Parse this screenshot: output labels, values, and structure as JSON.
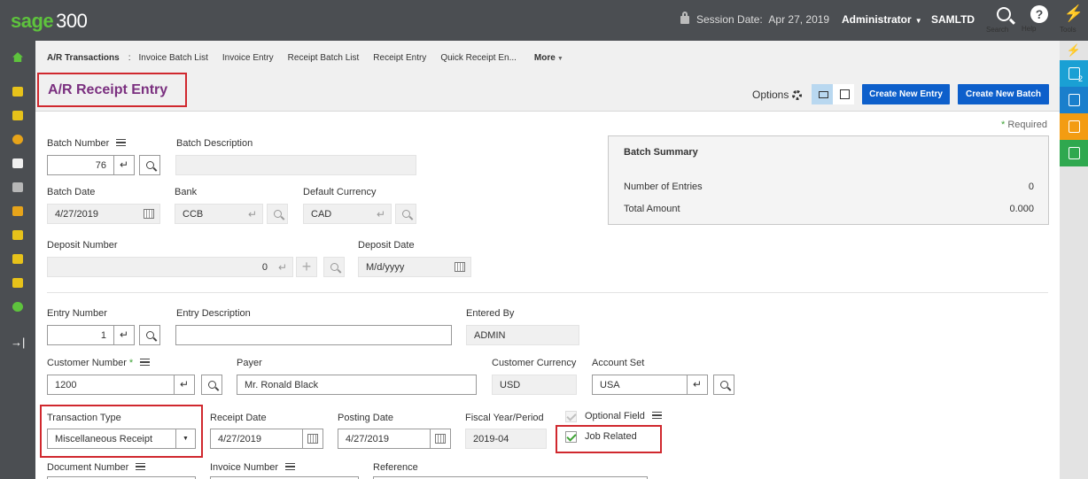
{
  "app": {
    "logo_name": "sage",
    "logo_num": "300",
    "session_label": "Session Date:",
    "session_date": "Apr 27, 2019",
    "user": "Administrator",
    "company": "SAMLTD",
    "search_label": "Search",
    "help_label": "Help",
    "tools_label": "Tools"
  },
  "rail": {
    "badge_count": "2",
    "colors": [
      "#1aa0d4",
      "#1a7fcc",
      "#f39c12",
      "#2fa84f"
    ]
  },
  "breadcrumb": {
    "root": "A/R Transactions",
    "sep": ":",
    "links": [
      "Invoice Batch List",
      "Invoice Entry",
      "Receipt Batch List",
      "Receipt Entry",
      "Quick Receipt En..."
    ],
    "more": "More"
  },
  "page": {
    "title": "A/R Receipt Entry",
    "options": "Options",
    "create_entry": "Create New Entry",
    "create_batch": "Create New Batch",
    "required": "Required"
  },
  "batch": {
    "number_label": "Batch Number",
    "number": "76",
    "description_label": "Batch Description",
    "description": "",
    "date_label": "Batch Date",
    "date": "4/27/2019",
    "bank_label": "Bank",
    "bank": "CCB",
    "currency_label": "Default Currency",
    "currency": "CAD",
    "deposit_number_label": "Deposit Number",
    "deposit_number": "0",
    "deposit_date_label": "Deposit Date",
    "deposit_date_placeholder": "M/d/yyyy"
  },
  "summary": {
    "title": "Batch Summary",
    "entries_label": "Number of Entries",
    "entries": "0",
    "total_label": "Total Amount",
    "total": "0.000"
  },
  "entry": {
    "number_label": "Entry Number",
    "number": "1",
    "description_label": "Entry Description",
    "description": "",
    "entered_by_label": "Entered By",
    "entered_by": "ADMIN",
    "customer_number_label": "Customer Number",
    "customer_number": "1200",
    "payer_label": "Payer",
    "payer": "Mr. Ronald Black",
    "customer_currency_label": "Customer Currency",
    "customer_currency": "USD",
    "account_set_label": "Account Set",
    "account_set": "USA",
    "transaction_type_label": "Transaction Type",
    "transaction_type": "Miscellaneous Receipt",
    "receipt_date_label": "Receipt Date",
    "receipt_date": "4/27/2019",
    "posting_date_label": "Posting Date",
    "posting_date": "4/27/2019",
    "fiscal_label": "Fiscal Year/Period",
    "fiscal": "2019-04",
    "optional_field_label": "Optional Field",
    "job_related_label": "Job Related",
    "document_number_label": "Document Number",
    "invoice_number_label": "Invoice Number",
    "reference_label": "Reference"
  }
}
